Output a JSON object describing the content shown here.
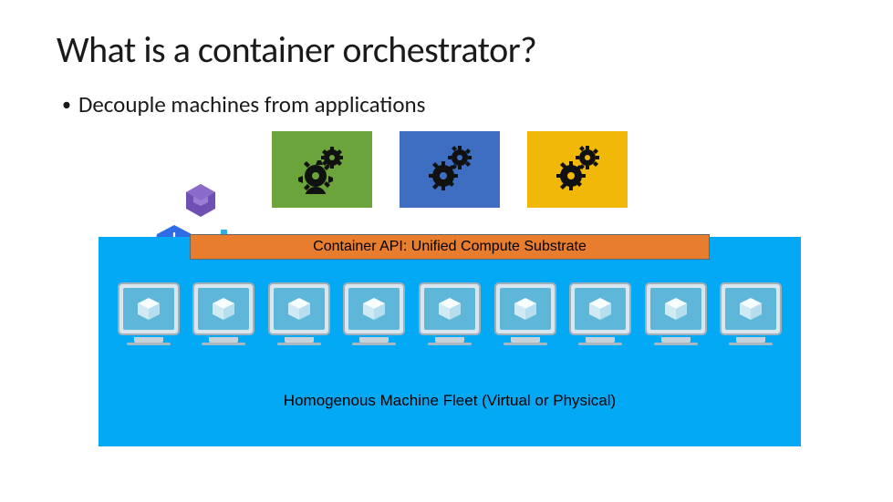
{
  "title": "What is a container orchestrator?",
  "bullet": "Decouple machines from applications",
  "apps": [
    {
      "name": "app-green",
      "color": "green"
    },
    {
      "name": "app-blue",
      "color": "blue"
    },
    {
      "name": "app-amber",
      "color": "amber"
    }
  ],
  "logos": {
    "nomos": "nomos-icon",
    "kube": "kubernetes-icon",
    "docker": "docker-icon"
  },
  "api_label": "Container API: Unified Compute Substrate",
  "fleet_label": "Homogenous Machine Fleet (Virtual or Physical)",
  "machine_count": 9,
  "colors": {
    "substrate": "#03A9F4",
    "api_bar": "#E77D2D",
    "green": "#6BA43A",
    "blue": "#3D6EC1",
    "amber": "#F2B807"
  }
}
